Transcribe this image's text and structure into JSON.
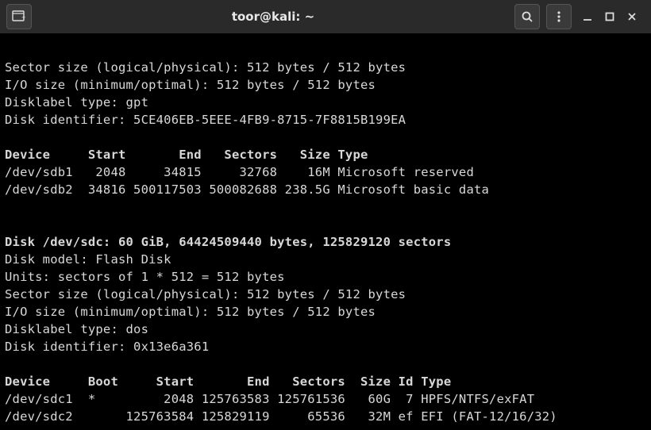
{
  "window": {
    "title": "toor@kali: ~"
  },
  "disk_b": {
    "sector_line": "Sector size (logical/physical): 512 bytes / 512 bytes",
    "io_line": "I/O size (minimum/optimal): 512 bytes / 512 bytes",
    "label_line": "Disklabel type: gpt",
    "id_line": "Disk identifier: 5CE406EB-5EEE-4FB9-8715-7F8815B199EA",
    "header": "Device     Start       End   Sectors   Size Type",
    "rows": [
      "/dev/sdb1   2048     34815     32768    16M Microsoft reserved",
      "/dev/sdb2  34816 500117503 500082688 238.5G Microsoft basic data"
    ]
  },
  "disk_c": {
    "disk_line": "Disk /dev/sdc: 60 GiB, 64424509440 bytes, 125829120 sectors",
    "model_line": "Disk model: Flash Disk",
    "units_line": "Units: sectors of 1 * 512 = 512 bytes",
    "sector_line": "Sector size (logical/physical): 512 bytes / 512 bytes",
    "io_line": "I/O size (minimum/optimal): 512 bytes / 512 bytes",
    "label_line": "Disklabel type: dos",
    "id_line": "Disk identifier: 0x13e6a361",
    "header": "Device     Boot     Start       End   Sectors  Size Id Type",
    "rows": [
      "/dev/sdc1  *         2048 125763583 125761536   60G  7 HPFS/NTFS/exFAT",
      "/dev/sdc2       125763584 125829119     65536   32M ef EFI (FAT-12/16/32)"
    ]
  }
}
